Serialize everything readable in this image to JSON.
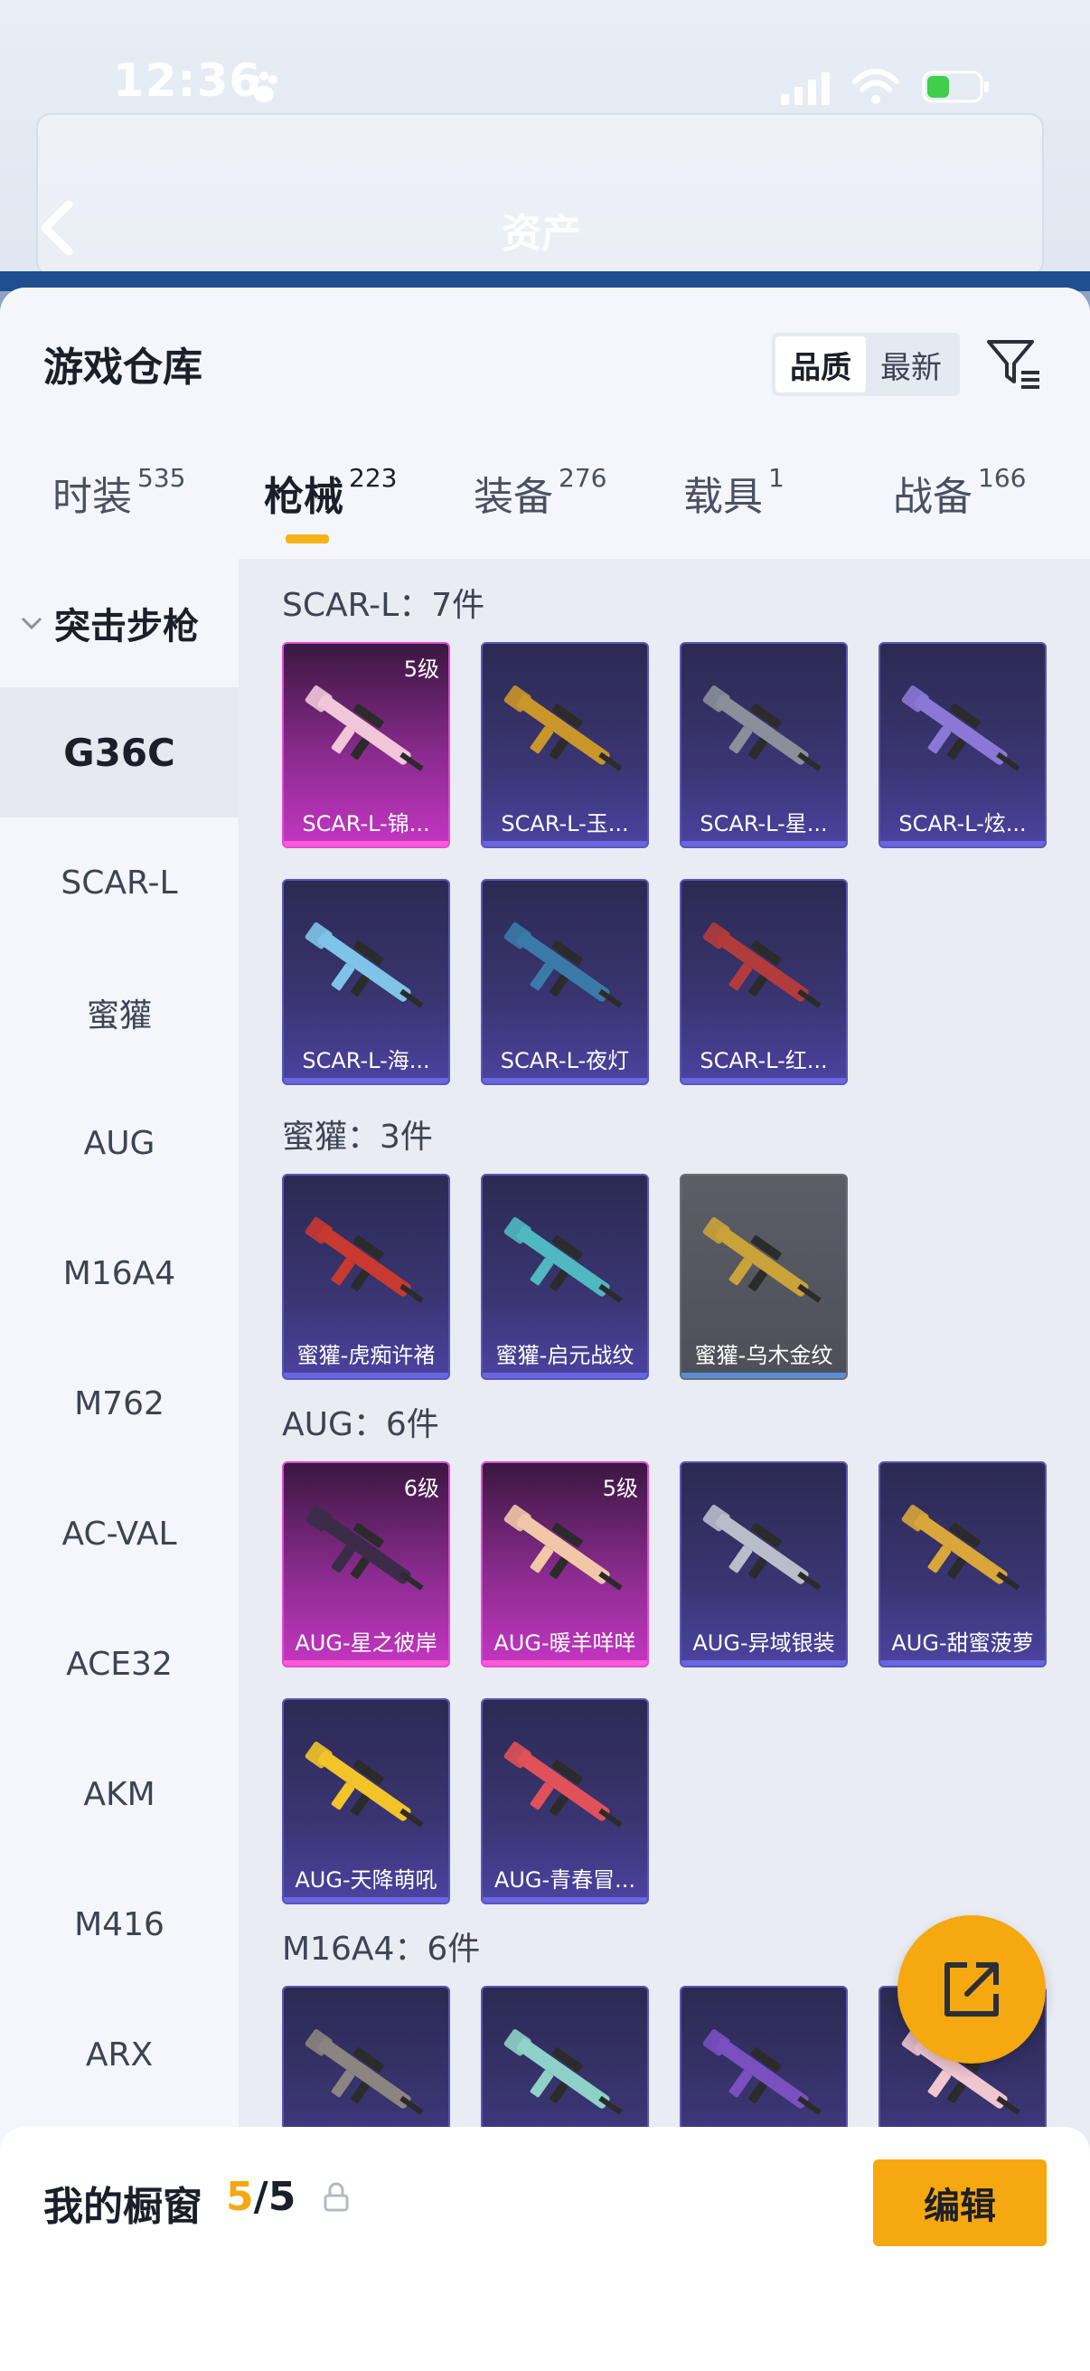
{
  "status_bar": {
    "time": "12:36"
  },
  "header": {
    "title": "资产"
  },
  "sheet": {
    "title": "游戏仓库",
    "sort_options": [
      "品质",
      "最新"
    ],
    "active_sort": "品质"
  },
  "tabs": [
    {
      "label": "时装",
      "count": "535"
    },
    {
      "label": "枪械",
      "count": "223"
    },
    {
      "label": "装备",
      "count": "276"
    },
    {
      "label": "载具",
      "count": "1"
    },
    {
      "label": "战备",
      "count": "166"
    }
  ],
  "active_tab": "枪械",
  "sidebar": {
    "category": "突击步枪",
    "items": [
      "G36C",
      "SCAR-L",
      "蜜獾",
      "AUG",
      "M16A4",
      "M762",
      "AC-VAL",
      "ACE32",
      "AKM",
      "M416",
      "ARX"
    ],
    "active": "G36C"
  },
  "groups": [
    {
      "title": "SCAR-L：7件",
      "items": [
        {
          "name": "SCAR-L-锦...",
          "level": "5级",
          "rarity": "pink",
          "gun_color": "#f1c6d8"
        },
        {
          "name": "SCAR-L-玉...",
          "level": "",
          "rarity": "purple",
          "gun_color": "#c9962a"
        },
        {
          "name": "SCAR-L-星...",
          "level": "",
          "rarity": "purple",
          "gun_color": "#8a8f99"
        },
        {
          "name": "SCAR-L-炫...",
          "level": "",
          "rarity": "purple",
          "gun_color": "#8b78d6"
        },
        {
          "name": "SCAR-L-海...",
          "level": "",
          "rarity": "purple",
          "gun_color": "#7fc4e8"
        },
        {
          "name": "SCAR-L-夜灯",
          "level": "",
          "rarity": "purple",
          "gun_color": "#3a7aa8"
        },
        {
          "name": "SCAR-L-红...",
          "level": "",
          "rarity": "purple",
          "gun_color": "#b23b3b"
        }
      ]
    },
    {
      "title": "蜜獾：3件",
      "items": [
        {
          "name": "蜜獾-虎痴许褚",
          "level": "",
          "rarity": "purple",
          "gun_color": "#c8392f"
        },
        {
          "name": "蜜獾-启元战纹",
          "level": "",
          "rarity": "purple",
          "gun_color": "#4fb8c0"
        },
        {
          "name": "蜜獾-乌木金纹",
          "level": "",
          "rarity": "gray",
          "gun_color": "#c9a23a"
        }
      ]
    },
    {
      "title": "AUG：6件",
      "items": [
        {
          "name": "AUG-星之彼岸",
          "level": "6级",
          "rarity": "pink",
          "gun_color": "#3b2c4a"
        },
        {
          "name": "AUG-暖羊咩咩",
          "level": "5级",
          "rarity": "pink",
          "gun_color": "#f2c7a8"
        },
        {
          "name": "AUG-异域银装",
          "level": "",
          "rarity": "purple",
          "gun_color": "#b9bdc9"
        },
        {
          "name": "AUG-甜蜜菠萝",
          "level": "",
          "rarity": "purple",
          "gun_color": "#d9a63a"
        },
        {
          "name": "AUG-天降萌吼",
          "level": "",
          "rarity": "purple",
          "gun_color": "#f2c42a"
        },
        {
          "name": "AUG-青春冒...",
          "level": "",
          "rarity": "purple",
          "gun_color": "#e0515a"
        }
      ]
    },
    {
      "title": "M16A4：6件",
      "items": [
        {
          "name": "",
          "level": "",
          "rarity": "purple",
          "gun_color": "#8a8580"
        },
        {
          "name": "",
          "level": "",
          "rarity": "purple",
          "gun_color": "#8ed1c8"
        },
        {
          "name": "",
          "level": "",
          "rarity": "purple",
          "gun_color": "#7a4fc0"
        },
        {
          "name": "",
          "level": "",
          "rarity": "purple",
          "gun_color": "#f0c6d0"
        }
      ]
    }
  ],
  "showcase": {
    "label": "我的橱窗",
    "current": "5",
    "total": "/5"
  },
  "edit_button": "编辑",
  "colors": {
    "accent": "#f5a80f",
    "tab_indicator": "#f5b318",
    "pink_rarity": "#e04bd6",
    "purple_rarity": "#5b55b8"
  }
}
